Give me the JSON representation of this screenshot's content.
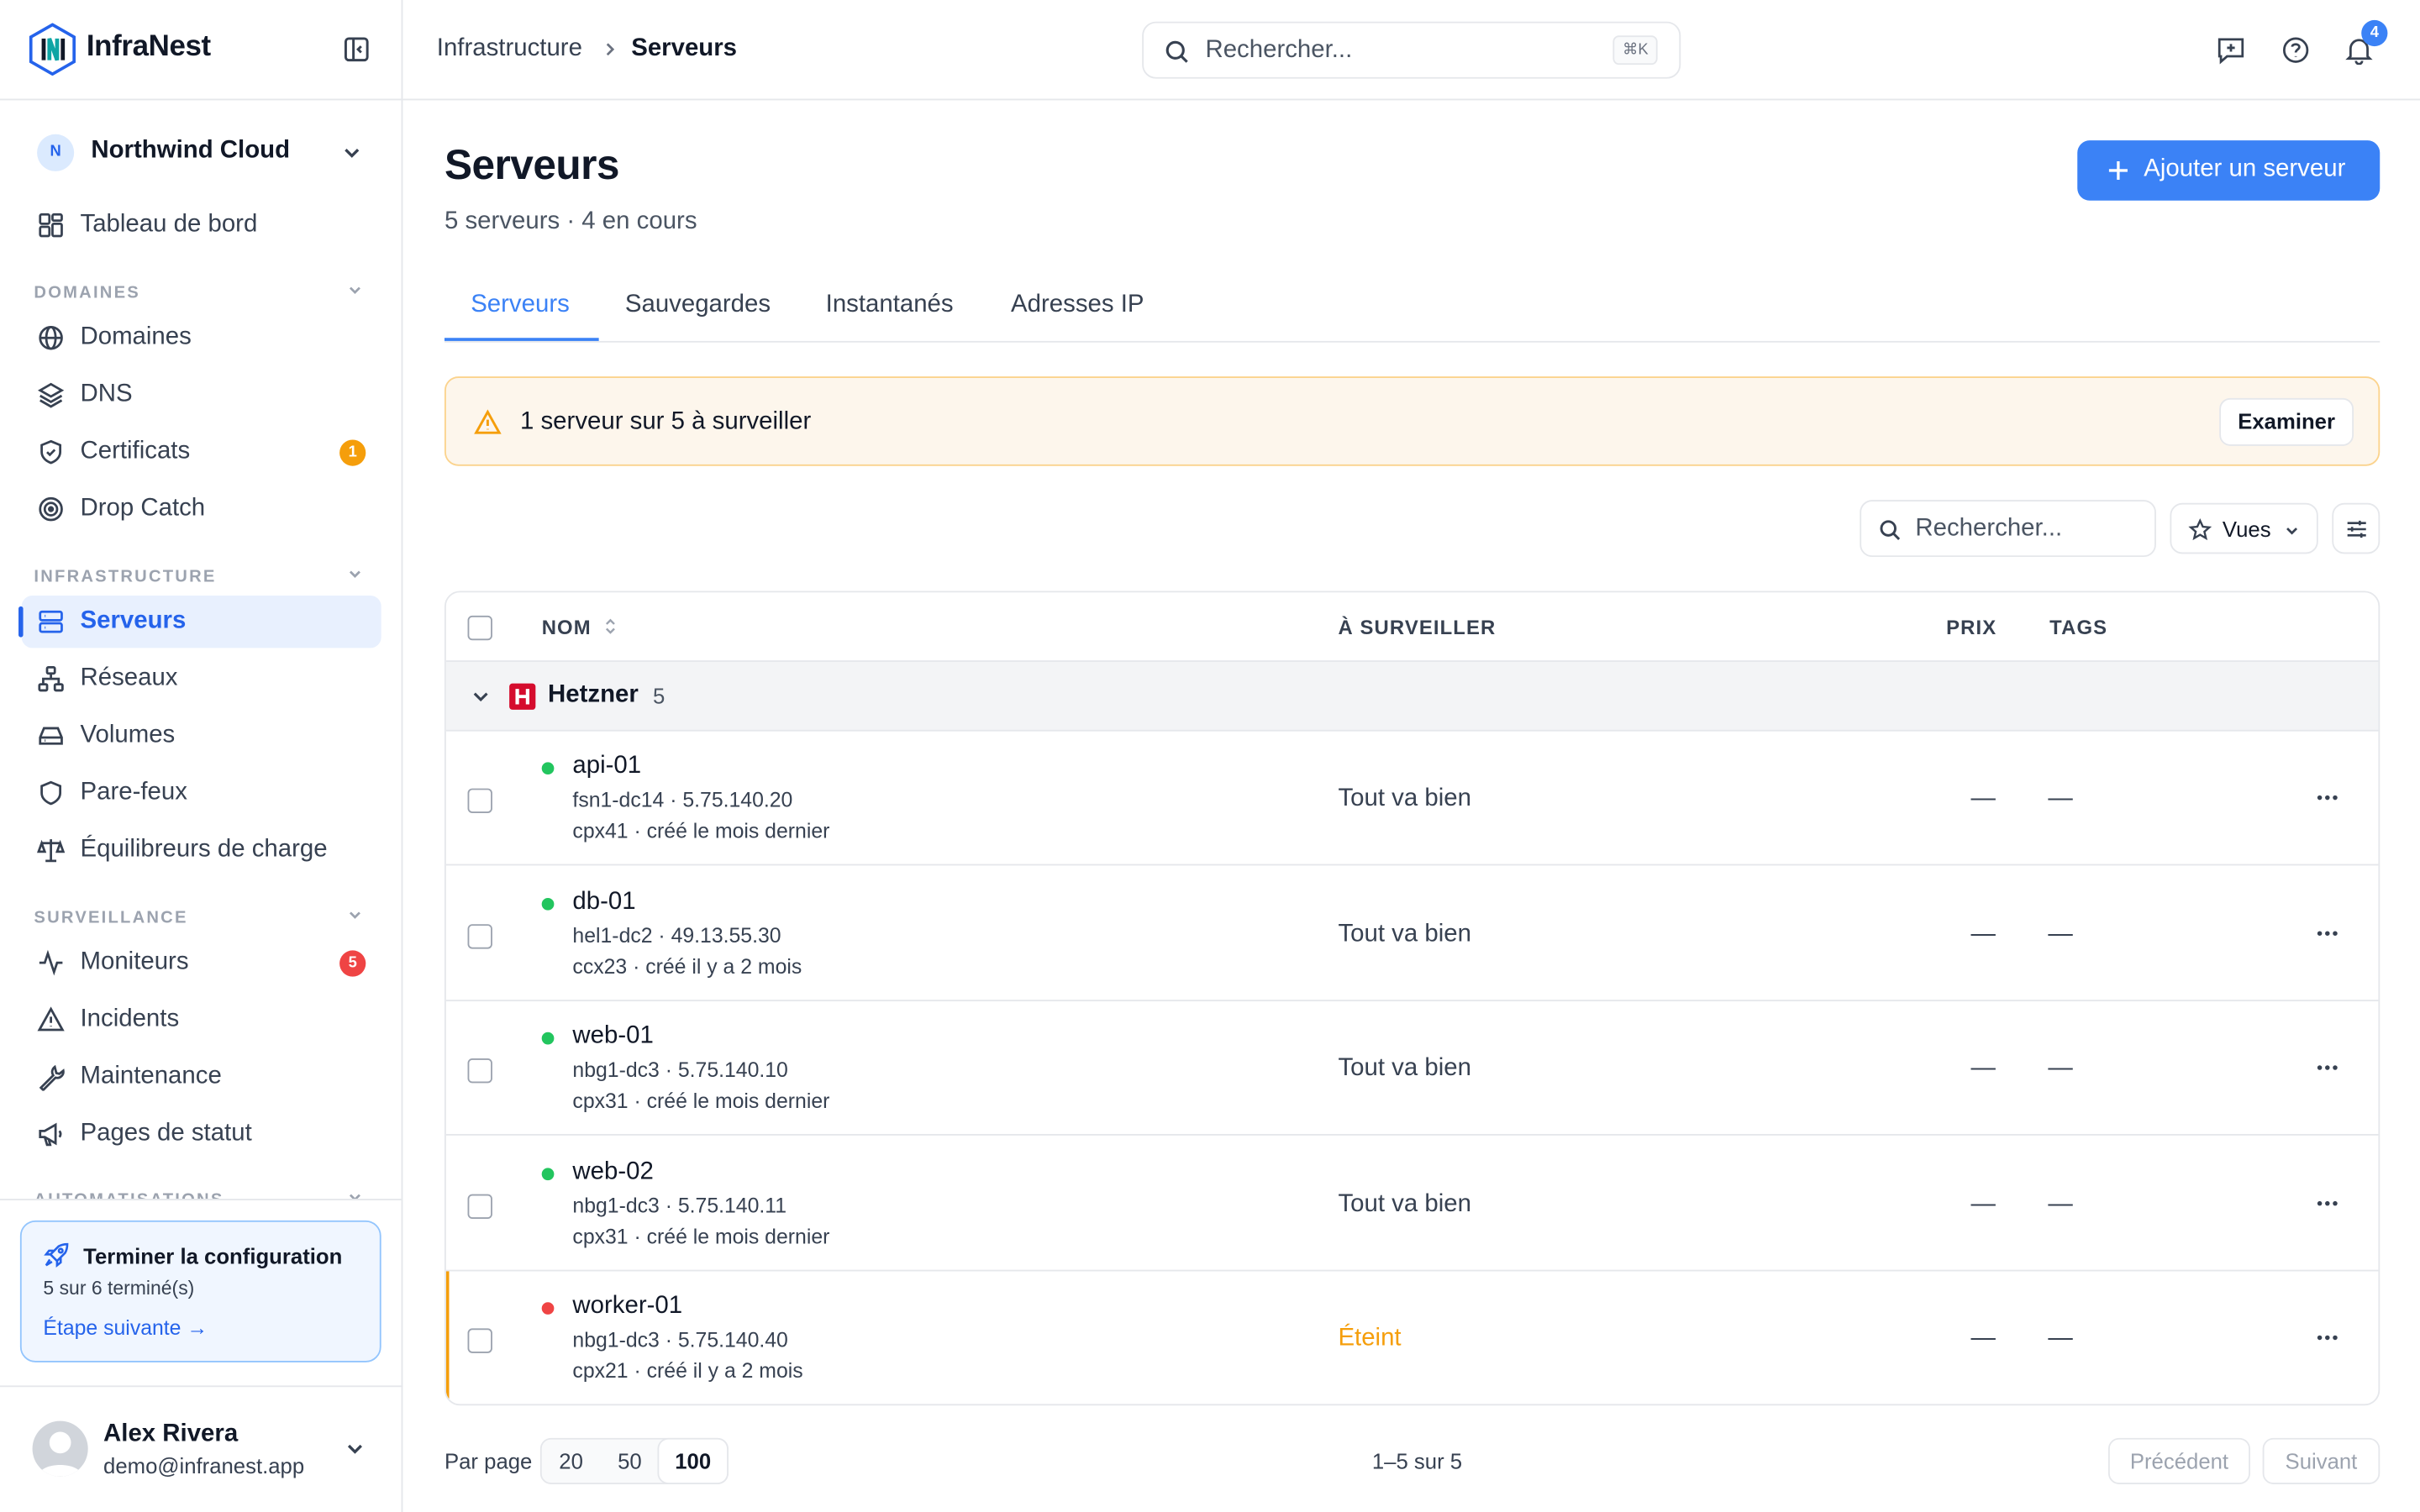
{
  "brand": {
    "name": "InfraNest"
  },
  "org": {
    "initial": "N",
    "name": "Northwind Cloud"
  },
  "nav": {
    "dashboard": "Tableau de bord",
    "sections": {
      "domains": "DOMAINES",
      "infrastructure": "INFRASTRUCTURE",
      "monitoring": "SURVEILLANCE",
      "automation": "AUTOMATISATIONS"
    },
    "domains": "Domaines",
    "dns": "DNS",
    "certificates": "Certificats",
    "certificates_badge": "1",
    "drop_catch": "Drop Catch",
    "servers": "Serveurs",
    "networks": "Réseaux",
    "volumes": "Volumes",
    "firewalls": "Pare-feux",
    "load_balancers": "Équilibreurs de charge",
    "monitors": "Moniteurs",
    "monitors_badge": "5",
    "incidents": "Incidents",
    "maintenance": "Maintenance",
    "status_pages": "Pages de statut"
  },
  "setup": {
    "title": "Terminer la configuration",
    "progress": "5 sur 6 terminé(s)",
    "next": "Étape suivante →"
  },
  "user": {
    "name": "Alex Rivera",
    "email": "demo@infranest.app"
  },
  "topbar": {
    "crumb_parent": "Infrastructure",
    "crumb_current": "Serveurs",
    "search_placeholder": "Rechercher...",
    "search_shortcut": "⌘K",
    "notifications_count": "4"
  },
  "page": {
    "title": "Serveurs",
    "subtitle": "5 serveurs · 4 en cours",
    "add_button": "Ajouter un serveur"
  },
  "tabs": [
    "Serveurs",
    "Sauvegardes",
    "Instantanés",
    "Adresses IP"
  ],
  "alert": {
    "text": "1 serveur sur 5 à surveiller",
    "action": "Examiner"
  },
  "toolbar": {
    "search_placeholder": "Rechercher...",
    "views": "Vues"
  },
  "table": {
    "columns": {
      "name": "NOM",
      "watch": "À SURVEILLER",
      "price": "PRIX",
      "tags": "TAGS"
    },
    "group": {
      "name": "Hetzner",
      "count": "5"
    },
    "rows": [
      {
        "name": "api-01",
        "location": "fsn1-dc14 · 5.75.140.20",
        "meta": "cpx41 · créé le mois dernier",
        "status": "Tout va bien",
        "state": "running",
        "price": "—",
        "tags": "—"
      },
      {
        "name": "db-01",
        "location": "hel1-dc2 · 49.13.55.30",
        "meta": "ccx23 · créé il y a 2 mois",
        "status": "Tout va bien",
        "state": "running",
        "price": "—",
        "tags": "—"
      },
      {
        "name": "web-01",
        "location": "nbg1-dc3 · 5.75.140.10",
        "meta": "cpx31 · créé le mois dernier",
        "status": "Tout va bien",
        "state": "running",
        "price": "—",
        "tags": "—"
      },
      {
        "name": "web-02",
        "location": "nbg1-dc3 · 5.75.140.11",
        "meta": "cpx31 · créé le mois dernier",
        "status": "Tout va bien",
        "state": "running",
        "price": "—",
        "tags": "—"
      },
      {
        "name": "worker-01",
        "location": "nbg1-dc3 · 5.75.140.40",
        "meta": "cpx21 · créé il y a 2 mois",
        "status": "Éteint",
        "state": "off",
        "price": "—",
        "tags": "—"
      }
    ]
  },
  "pagination": {
    "per_page_label": "Par page",
    "options": [
      "20",
      "50",
      "100"
    ],
    "selected": "100",
    "range": "1–5 sur 5",
    "prev": "Précédent",
    "next": "Suivant"
  },
  "colors": {
    "accent": "#3b82f6",
    "running": "#22c55e",
    "off": "#ef4444",
    "warning": "#f59e0b",
    "hetzner": "#d50c2d"
  }
}
